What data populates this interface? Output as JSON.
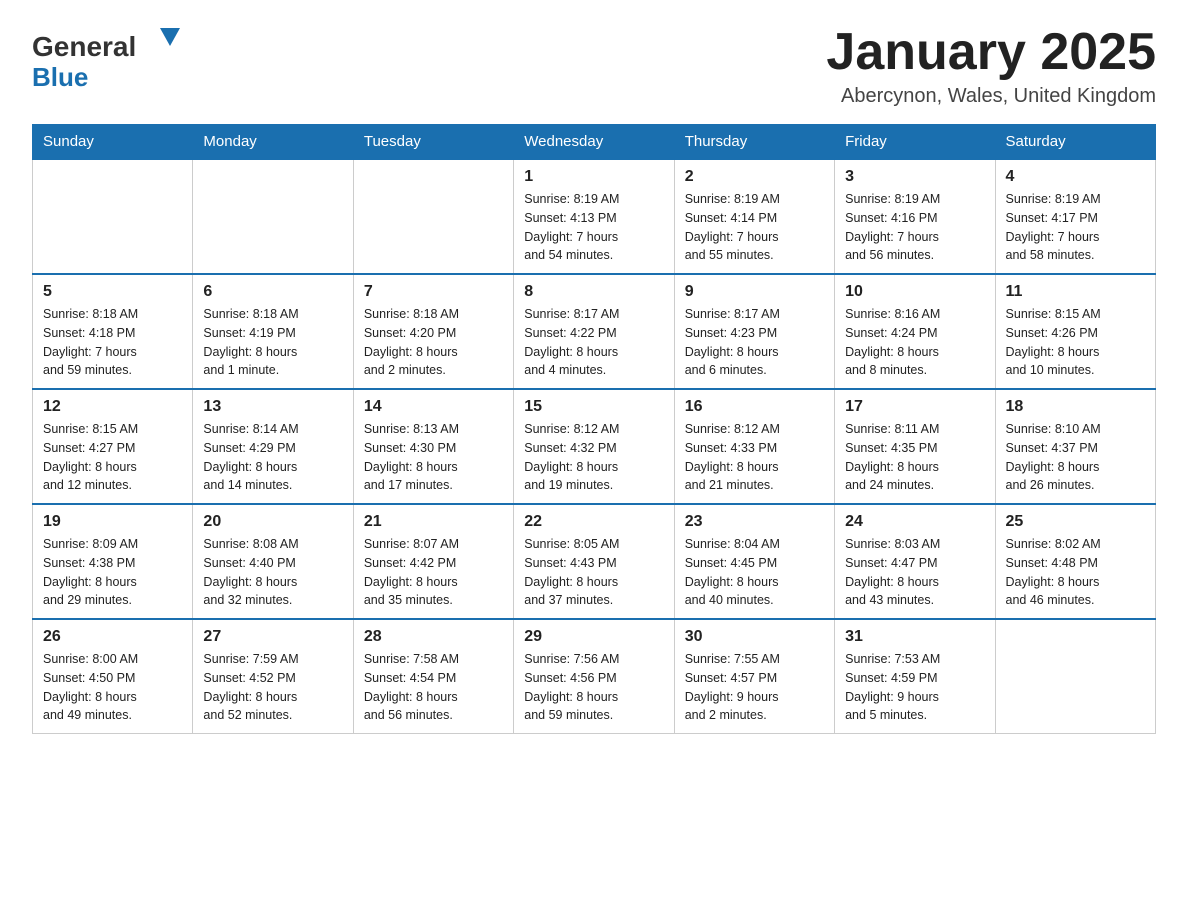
{
  "logo": {
    "general": "General",
    "blue": "Blue"
  },
  "header": {
    "title": "January 2025",
    "location": "Abercynon, Wales, United Kingdom"
  },
  "days_of_week": [
    "Sunday",
    "Monday",
    "Tuesday",
    "Wednesday",
    "Thursday",
    "Friday",
    "Saturday"
  ],
  "weeks": [
    [
      {
        "day": "",
        "info": ""
      },
      {
        "day": "",
        "info": ""
      },
      {
        "day": "",
        "info": ""
      },
      {
        "day": "1",
        "info": "Sunrise: 8:19 AM\nSunset: 4:13 PM\nDaylight: 7 hours\nand 54 minutes."
      },
      {
        "day": "2",
        "info": "Sunrise: 8:19 AM\nSunset: 4:14 PM\nDaylight: 7 hours\nand 55 minutes."
      },
      {
        "day": "3",
        "info": "Sunrise: 8:19 AM\nSunset: 4:16 PM\nDaylight: 7 hours\nand 56 minutes."
      },
      {
        "day": "4",
        "info": "Sunrise: 8:19 AM\nSunset: 4:17 PM\nDaylight: 7 hours\nand 58 minutes."
      }
    ],
    [
      {
        "day": "5",
        "info": "Sunrise: 8:18 AM\nSunset: 4:18 PM\nDaylight: 7 hours\nand 59 minutes."
      },
      {
        "day": "6",
        "info": "Sunrise: 8:18 AM\nSunset: 4:19 PM\nDaylight: 8 hours\nand 1 minute."
      },
      {
        "day": "7",
        "info": "Sunrise: 8:18 AM\nSunset: 4:20 PM\nDaylight: 8 hours\nand 2 minutes."
      },
      {
        "day": "8",
        "info": "Sunrise: 8:17 AM\nSunset: 4:22 PM\nDaylight: 8 hours\nand 4 minutes."
      },
      {
        "day": "9",
        "info": "Sunrise: 8:17 AM\nSunset: 4:23 PM\nDaylight: 8 hours\nand 6 minutes."
      },
      {
        "day": "10",
        "info": "Sunrise: 8:16 AM\nSunset: 4:24 PM\nDaylight: 8 hours\nand 8 minutes."
      },
      {
        "day": "11",
        "info": "Sunrise: 8:15 AM\nSunset: 4:26 PM\nDaylight: 8 hours\nand 10 minutes."
      }
    ],
    [
      {
        "day": "12",
        "info": "Sunrise: 8:15 AM\nSunset: 4:27 PM\nDaylight: 8 hours\nand 12 minutes."
      },
      {
        "day": "13",
        "info": "Sunrise: 8:14 AM\nSunset: 4:29 PM\nDaylight: 8 hours\nand 14 minutes."
      },
      {
        "day": "14",
        "info": "Sunrise: 8:13 AM\nSunset: 4:30 PM\nDaylight: 8 hours\nand 17 minutes."
      },
      {
        "day": "15",
        "info": "Sunrise: 8:12 AM\nSunset: 4:32 PM\nDaylight: 8 hours\nand 19 minutes."
      },
      {
        "day": "16",
        "info": "Sunrise: 8:12 AM\nSunset: 4:33 PM\nDaylight: 8 hours\nand 21 minutes."
      },
      {
        "day": "17",
        "info": "Sunrise: 8:11 AM\nSunset: 4:35 PM\nDaylight: 8 hours\nand 24 minutes."
      },
      {
        "day": "18",
        "info": "Sunrise: 8:10 AM\nSunset: 4:37 PM\nDaylight: 8 hours\nand 26 minutes."
      }
    ],
    [
      {
        "day": "19",
        "info": "Sunrise: 8:09 AM\nSunset: 4:38 PM\nDaylight: 8 hours\nand 29 minutes."
      },
      {
        "day": "20",
        "info": "Sunrise: 8:08 AM\nSunset: 4:40 PM\nDaylight: 8 hours\nand 32 minutes."
      },
      {
        "day": "21",
        "info": "Sunrise: 8:07 AM\nSunset: 4:42 PM\nDaylight: 8 hours\nand 35 minutes."
      },
      {
        "day": "22",
        "info": "Sunrise: 8:05 AM\nSunset: 4:43 PM\nDaylight: 8 hours\nand 37 minutes."
      },
      {
        "day": "23",
        "info": "Sunrise: 8:04 AM\nSunset: 4:45 PM\nDaylight: 8 hours\nand 40 minutes."
      },
      {
        "day": "24",
        "info": "Sunrise: 8:03 AM\nSunset: 4:47 PM\nDaylight: 8 hours\nand 43 minutes."
      },
      {
        "day": "25",
        "info": "Sunrise: 8:02 AM\nSunset: 4:48 PM\nDaylight: 8 hours\nand 46 minutes."
      }
    ],
    [
      {
        "day": "26",
        "info": "Sunrise: 8:00 AM\nSunset: 4:50 PM\nDaylight: 8 hours\nand 49 minutes."
      },
      {
        "day": "27",
        "info": "Sunrise: 7:59 AM\nSunset: 4:52 PM\nDaylight: 8 hours\nand 52 minutes."
      },
      {
        "day": "28",
        "info": "Sunrise: 7:58 AM\nSunset: 4:54 PM\nDaylight: 8 hours\nand 56 minutes."
      },
      {
        "day": "29",
        "info": "Sunrise: 7:56 AM\nSunset: 4:56 PM\nDaylight: 8 hours\nand 59 minutes."
      },
      {
        "day": "30",
        "info": "Sunrise: 7:55 AM\nSunset: 4:57 PM\nDaylight: 9 hours\nand 2 minutes."
      },
      {
        "day": "31",
        "info": "Sunrise: 7:53 AM\nSunset: 4:59 PM\nDaylight: 9 hours\nand 5 minutes."
      },
      {
        "day": "",
        "info": ""
      }
    ]
  ]
}
